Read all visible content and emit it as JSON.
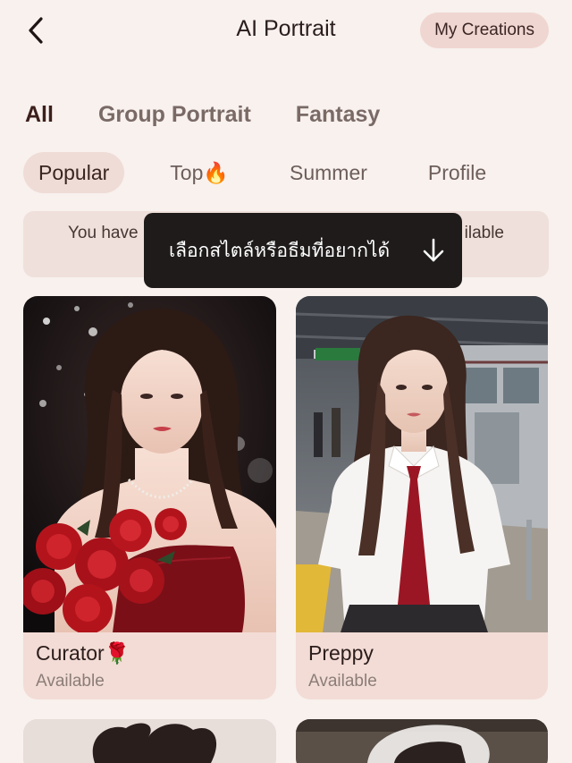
{
  "header": {
    "title": "AI Portrait",
    "my_creations_label": "My Creations"
  },
  "category_tabs": [
    {
      "label": "All",
      "active": true
    },
    {
      "label": "Group Portrait",
      "active": false
    },
    {
      "label": "Fantasy",
      "active": false
    }
  ],
  "sub_tabs": [
    {
      "label": "Popular",
      "active": true
    },
    {
      "label": "Top🔥",
      "active": false
    },
    {
      "label": "Summer",
      "active": false
    },
    {
      "label": "Profile",
      "active": false
    }
  ],
  "notice": {
    "text_left": "You have",
    "text_right": "ilable"
  },
  "tooltip": {
    "text": "เลือกสไตล์หรือธีมที่อยากได้",
    "icon": "arrow-down-icon"
  },
  "cards": [
    {
      "name": "Curator🌹",
      "status": "Available"
    },
    {
      "name": "Preppy",
      "status": "Available"
    }
  ],
  "colors": {
    "background": "#f8f1ee",
    "chip_active": "#efdcd6",
    "card_footer": "#f3dcd6",
    "tooltip_bg": "#1f1b1b",
    "rose_red": "#b3141c"
  }
}
